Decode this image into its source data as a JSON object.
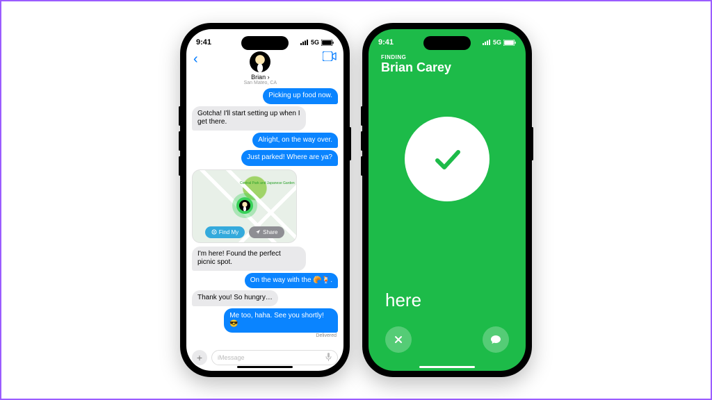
{
  "status": {
    "time": "9:41",
    "network": "5G"
  },
  "messages": {
    "contact": {
      "name": "Brian",
      "sublabel": "San Mateo, CA"
    },
    "thread": [
      {
        "type": "sent",
        "text": "Picking up food now."
      },
      {
        "type": "rcvd",
        "text": "Gotcha! I'll start setting up when I get there."
      },
      {
        "type": "sent",
        "text": "Alright, on the way over."
      },
      {
        "type": "sent",
        "text": "Just parked! Where are ya?"
      }
    ],
    "map": {
      "label": "Central Park and Japanese Garden",
      "findmy": "Find My",
      "share": "Share"
    },
    "thread2": [
      {
        "type": "rcvd",
        "text": "I'm here! Found the perfect picnic spot."
      },
      {
        "type": "sent",
        "text": "On the way with the 🥐🍹."
      },
      {
        "type": "rcvd",
        "text": "Thank you! So hungry…"
      },
      {
        "type": "sent",
        "text": "Me too, haha. See you shortly! 😎"
      }
    ],
    "delivered": "Delivered",
    "placeholder": "iMessage"
  },
  "findmy": {
    "label": "FINDING",
    "name": "Brian Carey",
    "status": "here"
  }
}
